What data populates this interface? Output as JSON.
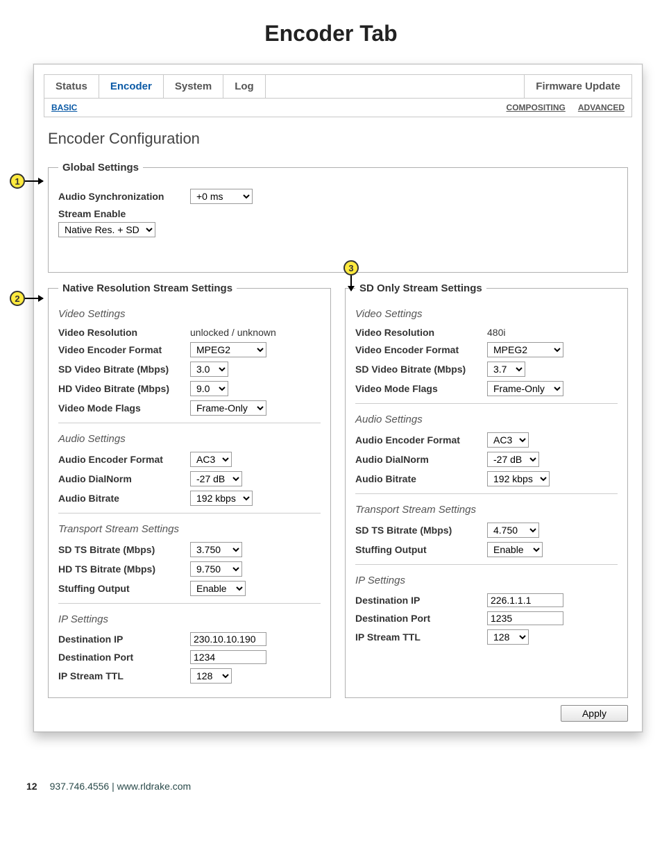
{
  "page_title": "Encoder Tab",
  "tabs": {
    "status": "Status",
    "encoder": "Encoder",
    "system": "System",
    "log": "Log",
    "firmware": "Firmware Update"
  },
  "subtabs": {
    "basic": "BASIC",
    "compositing": "COMPOSITING",
    "advanced": "ADVANCED"
  },
  "section_title": "Encoder Configuration",
  "callouts": {
    "c1": "1",
    "c2": "2",
    "c3": "3"
  },
  "global": {
    "legend": "Global Settings",
    "audio_sync_label": "Audio Synchronization",
    "audio_sync_value": "+0 ms",
    "stream_enable_label": "Stream Enable",
    "stream_enable_value": "Native Res. + SD"
  },
  "native": {
    "legend": "Native Resolution Stream Settings",
    "video": {
      "title": "Video Settings",
      "resolution_label": "Video Resolution",
      "resolution_value": "unlocked / unknown",
      "vformat_label": "Video Encoder Format",
      "vformat_value": "MPEG2",
      "sd_br_label": "SD Video Bitrate (Mbps)",
      "sd_br_value": "3.0",
      "hd_br_label": "HD Video Bitrate (Mbps)",
      "hd_br_value": "9.0",
      "flags_label": "Video Mode Flags",
      "flags_value": "Frame-Only"
    },
    "audio": {
      "title": "Audio Settings",
      "aformat_label": "Audio Encoder Format",
      "aformat_value": "AC3",
      "dialnorm_label": "Audio DialNorm",
      "dialnorm_value": "-27 dB",
      "abitrate_label": "Audio Bitrate",
      "abitrate_value": "192 kbps"
    },
    "ts": {
      "title": "Transport Stream Settings",
      "sd_ts_label": "SD TS Bitrate (Mbps)",
      "sd_ts_value": "3.750",
      "hd_ts_label": "HD TS Bitrate (Mbps)",
      "hd_ts_value": "9.750",
      "stuff_label": "Stuffing Output",
      "stuff_value": "Enable"
    },
    "ip": {
      "title": "IP Settings",
      "dip_label": "Destination IP",
      "dip_value": "230.10.10.190",
      "dport_label": "Destination Port",
      "dport_value": "1234",
      "ttl_label": "IP Stream TTL",
      "ttl_value": "128"
    }
  },
  "sd": {
    "legend": "SD Only Stream Settings",
    "video": {
      "title": "Video Settings",
      "resolution_label": "Video Resolution",
      "resolution_value": "480i",
      "vformat_label": "Video Encoder Format",
      "vformat_value": "MPEG2",
      "sd_br_label": "SD Video Bitrate (Mbps)",
      "sd_br_value": "3.7",
      "flags_label": "Video Mode Flags",
      "flags_value": "Frame-Only"
    },
    "audio": {
      "title": "Audio Settings",
      "aformat_label": "Audio Encoder Format",
      "aformat_value": "AC3",
      "dialnorm_label": "Audio DialNorm",
      "dialnorm_value": "-27 dB",
      "abitrate_label": "Audio Bitrate",
      "abitrate_value": "192 kbps"
    },
    "ts": {
      "title": "Transport Stream Settings",
      "sd_ts_label": "SD TS Bitrate (Mbps)",
      "sd_ts_value": "4.750",
      "stuff_label": "Stuffing Output",
      "stuff_value": "Enable"
    },
    "ip": {
      "title": "IP Settings",
      "dip_label": "Destination IP",
      "dip_value": "226.1.1.1",
      "dport_label": "Destination Port",
      "dport_value": "1235",
      "ttl_label": "IP Stream TTL",
      "ttl_value": "128"
    }
  },
  "apply_label": "Apply",
  "footer": {
    "page": "12",
    "contact": "937.746.4556 | www.rldrake.com"
  }
}
